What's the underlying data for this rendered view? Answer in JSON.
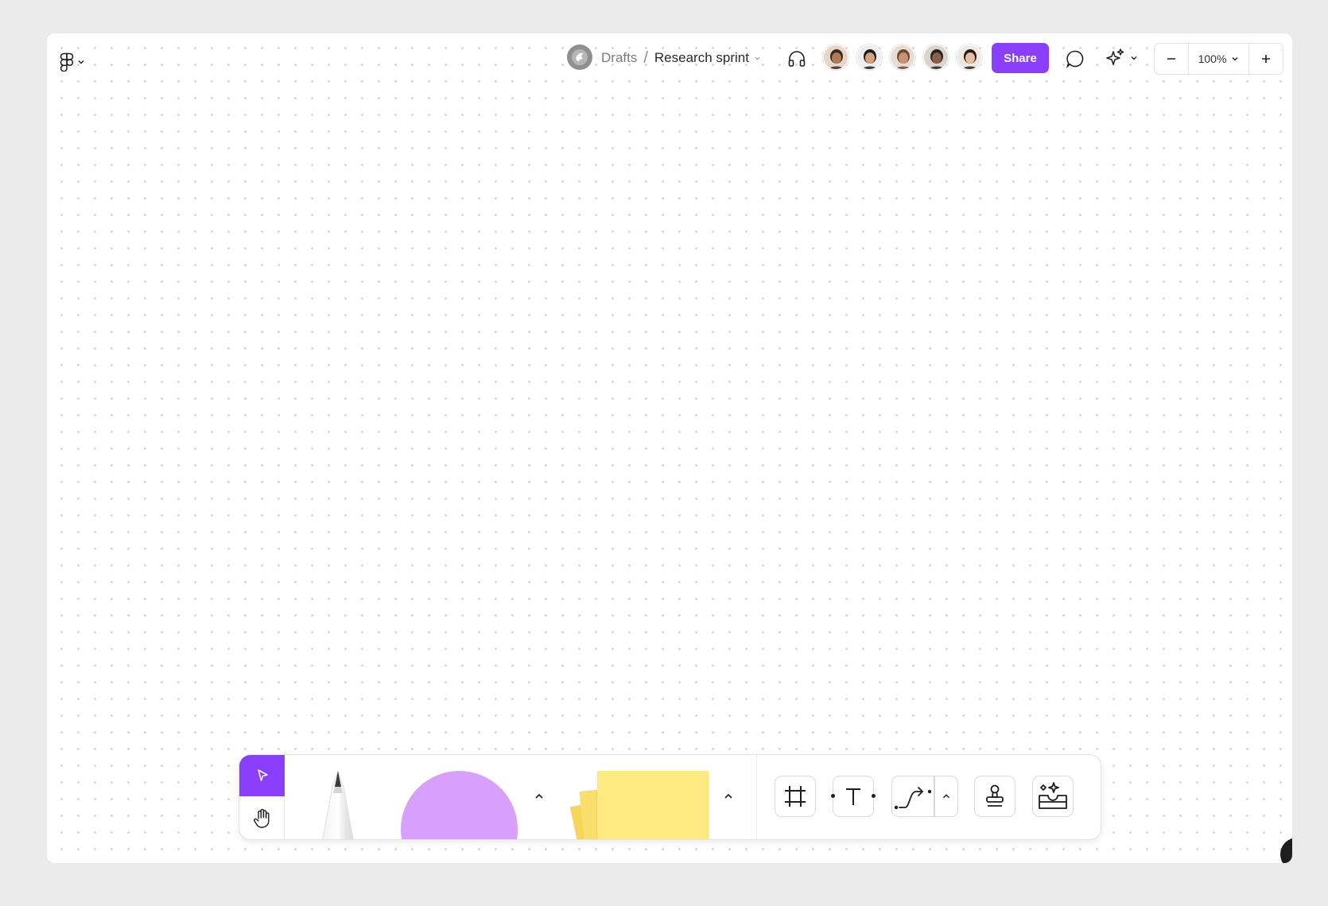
{
  "app": {
    "logo_icon": "figma-logo-icon",
    "menu_chevron": "chevron-down-icon"
  },
  "breadcrumb": {
    "team_icon": "team-avatar",
    "parent": "Drafts",
    "separator": "/",
    "current": "Research sprint"
  },
  "header": {
    "audio_icon": "headphones-icon",
    "collaborators": [
      {
        "name": "collaborator-1",
        "skin": "#b07a55",
        "hair": "#3a2a1e",
        "bg": "#e8d7c4"
      },
      {
        "name": "collaborator-2",
        "skin": "#d4a07e",
        "hair": "#1e1a18",
        "bg": "#ededed"
      },
      {
        "name": "collaborator-3",
        "skin": "#c99273",
        "hair": "#6b4a34",
        "bg": "#e6dcd2"
      },
      {
        "name": "collaborator-4",
        "skin": "#8a5f45",
        "hair": "#2b211b",
        "bg": "#d9d4cf"
      },
      {
        "name": "collaborator-5",
        "skin": "#e7bfa1",
        "hair": "#2a1d17",
        "bg": "#f0e8e0"
      }
    ],
    "share_label": "Share",
    "share_color": "#8a3ffc",
    "comment_icon": "comment-icon",
    "ai_icon": "ai-sparkle-icon"
  },
  "zoom": {
    "out_icon": "minus-icon",
    "level": "100%",
    "in_icon": "plus-icon"
  },
  "toolbar": {
    "tools": [
      {
        "id": "move",
        "icon": "cursor-arrow-icon",
        "active": true
      },
      {
        "id": "hand",
        "icon": "hand-icon",
        "active": false
      },
      {
        "id": "pencil",
        "icon": "marker-icon"
      },
      {
        "id": "shape",
        "icon": "circle-shape-icon",
        "color": "#d8a0fa"
      },
      {
        "id": "sticky",
        "icon": "sticky-note-icon",
        "color": "#ffe981"
      },
      {
        "id": "frame",
        "icon": "frame-icon"
      },
      {
        "id": "text",
        "icon": "text-icon"
      },
      {
        "id": "connector",
        "icon": "connector-icon"
      },
      {
        "id": "stamp",
        "icon": "stamp-icon"
      },
      {
        "id": "more",
        "icon": "more-tools-icon"
      }
    ],
    "accent": "#8a3ffc"
  },
  "help": {
    "label": "?"
  }
}
